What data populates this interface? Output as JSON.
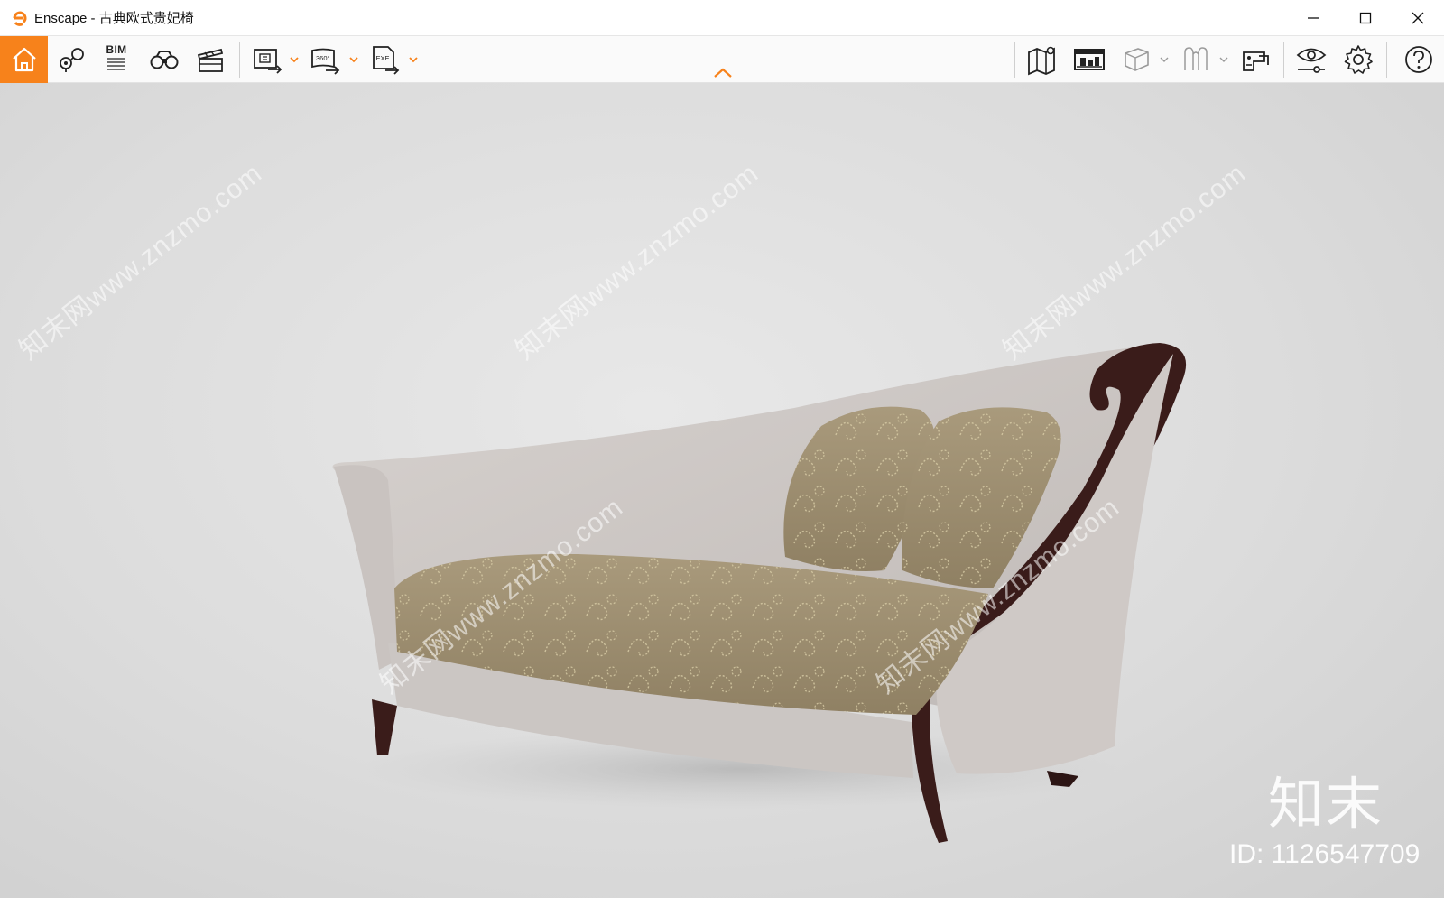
{
  "window": {
    "app_name": "Enscape",
    "title": "Enscape - 古典欧式贵妃椅",
    "controls": [
      "minimize",
      "maximize",
      "close"
    ]
  },
  "toolbar": {
    "left_icons": [
      "home-icon",
      "sync-views-icon",
      "bim-icon",
      "binoculars-icon",
      "video-editor-icon",
      "screenshot-export-icon",
      "panorama-export-icon",
      "exe-export-icon"
    ],
    "bim_label": "BIM",
    "panorama_label": "360°",
    "exe_label": "EXE",
    "right_icons": [
      "map-icon",
      "asset-library-icon",
      "cube-icon",
      "vr-headset-icon",
      "collaborate-icon",
      "visual-settings-icon",
      "settings-gear-icon",
      "help-icon"
    ],
    "accent_color": "#f7821b"
  },
  "viewport": {
    "watermark_text": "知末网www.znzmo.com",
    "watermark_logo": "知末",
    "watermark_id": "ID: 1126547709"
  }
}
